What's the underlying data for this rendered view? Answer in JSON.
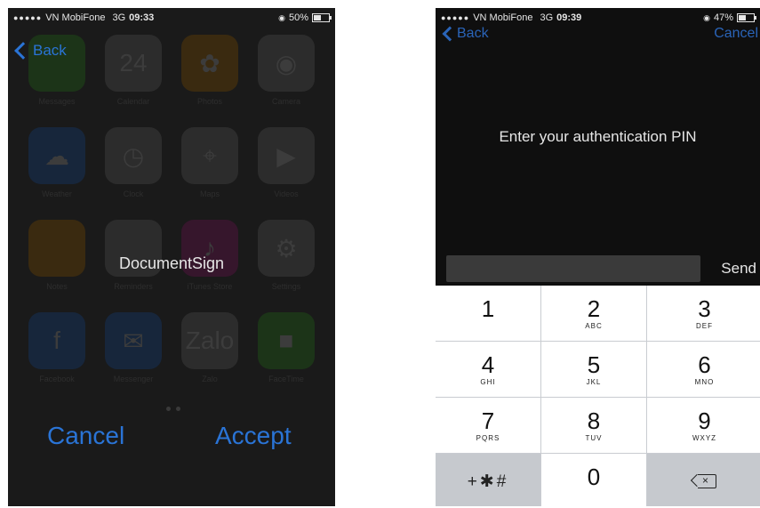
{
  "left_screen": {
    "status": {
      "signal": "●●●●●",
      "carrier": "VN MobiFone",
      "network": "3G",
      "time": "09:33",
      "battery": "50%",
      "battery_level": 0.5
    },
    "back_label": "Back",
    "home_apps": [
      {
        "label": "Messages",
        "glyph": "",
        "color": "green"
      },
      {
        "label": "Calendar",
        "glyph": "24",
        "color": "gray"
      },
      {
        "label": "Photos",
        "glyph": "✿",
        "color": "orange"
      },
      {
        "label": "Camera",
        "glyph": "◉",
        "color": "gray"
      },
      {
        "label": "Weather",
        "glyph": "☁",
        "color": "blue"
      },
      {
        "label": "Clock",
        "glyph": "◷",
        "color": "gray"
      },
      {
        "label": "Maps",
        "glyph": "⌖",
        "color": "gray"
      },
      {
        "label": "Videos",
        "glyph": "▶",
        "color": "gray"
      },
      {
        "label": "Notes",
        "glyph": "",
        "color": "orange"
      },
      {
        "label": "Reminders",
        "glyph": "",
        "color": "gray"
      },
      {
        "label": "iTunes Store",
        "glyph": "♪",
        "color": "pink"
      },
      {
        "label": "Settings",
        "glyph": "⚙",
        "color": "gray"
      },
      {
        "label": "Facebook",
        "glyph": "f",
        "color": "blue"
      },
      {
        "label": "Messenger",
        "glyph": "✉",
        "color": "blue"
      },
      {
        "label": "Zalo",
        "glyph": "Zalo",
        "color": "gray"
      },
      {
        "label": "FaceTime",
        "glyph": "■",
        "color": "green"
      }
    ],
    "dialog_title": "DocumentSign",
    "cancel_label": "Cancel",
    "accept_label": "Accept"
  },
  "right_screen": {
    "status": {
      "signal": "●●●●●",
      "carrier": "VN MobiFone",
      "network": "3G",
      "time": "09:39",
      "battery": "47%",
      "battery_level": 0.47
    },
    "back_label": "Back",
    "cancel_label": "Cancel",
    "prompt": "Enter your authentication PIN",
    "pin_value": "",
    "send_label": "Send",
    "keys": [
      {
        "num": "1",
        "letters": ""
      },
      {
        "num": "2",
        "letters": "ABC"
      },
      {
        "num": "3",
        "letters": "DEF"
      },
      {
        "num": "4",
        "letters": "GHI"
      },
      {
        "num": "5",
        "letters": "JKL"
      },
      {
        "num": "6",
        "letters": "MNO"
      },
      {
        "num": "7",
        "letters": "PQRS"
      },
      {
        "num": "8",
        "letters": "TUV"
      },
      {
        "num": "9",
        "letters": "WXYZ"
      }
    ],
    "symbols_label": "+✱#",
    "zero_label": "0"
  },
  "colors": {
    "ios_blue": "#2a74d6",
    "dark_bg": "#1a1a1a",
    "keypad_bg": "#ffffff",
    "keypad_function_bg": "#c6c9ce"
  }
}
